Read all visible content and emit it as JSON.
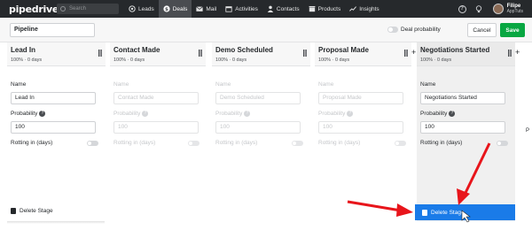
{
  "app": {
    "logo": "pipedrive"
  },
  "search": {
    "placeholder": "Search"
  },
  "nav": [
    {
      "label": "Leads",
      "icon": "target-icon"
    },
    {
      "label": "Deals",
      "icon": "dollar-icon",
      "active": true
    },
    {
      "label": "Mail",
      "icon": "mail-icon"
    },
    {
      "label": "Activities",
      "icon": "calendar-icon"
    },
    {
      "label": "Contacts",
      "icon": "person-icon"
    },
    {
      "label": "Products",
      "icon": "box-icon"
    },
    {
      "label": "Insights",
      "icon": "chart-icon"
    }
  ],
  "user": {
    "name": "Filipe",
    "company": "AppTuts"
  },
  "toolbar": {
    "pipeline_name": "Pipeline",
    "deal_probability": "Deal probability",
    "cancel": "Cancel",
    "save": "Save"
  },
  "stages": [
    {
      "title": "Lead In",
      "meta": "100%  ·  0 days",
      "name_value": "Lead In",
      "probability": "100"
    },
    {
      "title": "Contact Made",
      "meta": "100%  ·  0 days",
      "name_value": "Contact Made",
      "probability": "100"
    },
    {
      "title": "Demo Scheduled",
      "meta": "100%  ·  0 days",
      "name_value": "Demo Scheduled",
      "probability": "100"
    },
    {
      "title": "Proposal Made",
      "meta": "100%  ·  0 days",
      "name_value": "Proposal Made",
      "probability": "100"
    },
    {
      "title": "Negotiations Started",
      "meta": "100%  ·  0 days",
      "name_value": "Negotiations Started",
      "probability": "100"
    }
  ],
  "form": {
    "name_label": "Name",
    "probability_label": "Probability",
    "rotting_label": "Rotting in (days)",
    "delete_label": "Delete Stage"
  },
  "misc": {
    "edge_letter": "P"
  },
  "colors": {
    "topbar": "#26292c",
    "save": "#08a742",
    "delete_active": "#1a7be8",
    "arrow": "#e8151b"
  }
}
